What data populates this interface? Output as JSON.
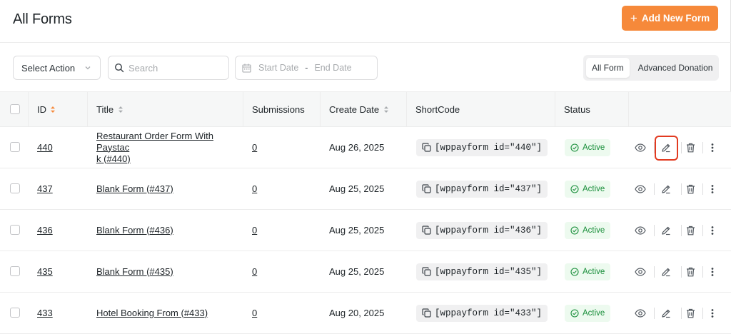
{
  "header": {
    "title": "All Forms",
    "add_button_label": "Add New Form",
    "accent_color": "#f6893a"
  },
  "filters": {
    "bulk_action_label": "Select Action",
    "search_placeholder": "Search",
    "start_date_placeholder": "Start Date",
    "date_separator": "-",
    "end_date_placeholder": "End Date",
    "tabs": [
      {
        "label": "All Form",
        "active": true
      },
      {
        "label": "Advanced Donation",
        "active": false
      }
    ]
  },
  "table": {
    "columns": {
      "id": "ID",
      "title": "Title",
      "submissions": "Submissions",
      "create_date": "Create Date",
      "shortcode": "ShortCode",
      "status": "Status"
    },
    "rows": [
      {
        "id": "440",
        "title_line1": "Restaurant Order Form With Paystac",
        "title_line2": "k (#440)",
        "submissions": "0",
        "date": "Aug 26, 2025",
        "shortcode": "[wppayform id=\"440\"]",
        "status": "Active"
      },
      {
        "id": "437",
        "title_line1": "Blank Form (#437)",
        "title_line2": "",
        "submissions": "0",
        "date": "Aug 25, 2025",
        "shortcode": "[wppayform id=\"437\"]",
        "status": "Active"
      },
      {
        "id": "436",
        "title_line1": "Blank Form (#436)",
        "title_line2": "",
        "submissions": "0",
        "date": "Aug 25, 2025",
        "shortcode": "[wppayform id=\"436\"]",
        "status": "Active"
      },
      {
        "id": "435",
        "title_line1": "Blank Form (#435)",
        "title_line2": "",
        "submissions": "0",
        "date": "Aug 25, 2025",
        "shortcode": "[wppayform id=\"435\"]",
        "status": "Active"
      },
      {
        "id": "433",
        "title_line1": "Hotel Booking From (#433)",
        "title_line2": "",
        "submissions": "0",
        "date": "Aug 20, 2025",
        "shortcode": "[wppayform id=\"433\"]",
        "status": "Active"
      }
    ]
  }
}
